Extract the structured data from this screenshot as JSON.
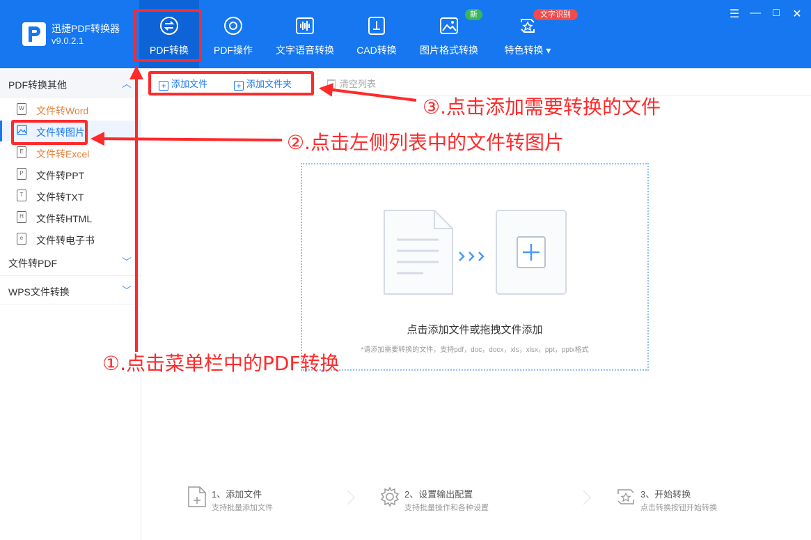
{
  "app": {
    "name": "迅捷PDF转换器",
    "version": "v9.0.2.1"
  },
  "nav": [
    {
      "label": "PDF转换",
      "icon": "convert-icon",
      "active": true
    },
    {
      "label": "PDF操作",
      "icon": "gear-circle-icon"
    },
    {
      "label": "文字语音转换",
      "icon": "waveform-icon"
    },
    {
      "label": "CAD转换",
      "icon": "cad-icon"
    },
    {
      "label": "图片格式转换",
      "icon": "image-icon"
    },
    {
      "label": "特色转换",
      "icon": "special-icon",
      "dropdown": true
    }
  ],
  "badges": {
    "new": "新",
    "ocr": "文字识别"
  },
  "window_controls": {
    "menu": "☰",
    "minimize": "—",
    "maximize": "□",
    "close": "✕"
  },
  "sidebar": {
    "groups": [
      {
        "label": "PDF转换其他",
        "expanded": true,
        "items": [
          {
            "label": "文件转Word",
            "icon_text": "W"
          },
          {
            "label": "文件转图片",
            "icon_text": "img",
            "active": true
          },
          {
            "label": "文件转Excel",
            "icon_text": "E"
          },
          {
            "label": "文件转PPT",
            "icon_text": "P"
          },
          {
            "label": "文件转TXT",
            "icon_text": "T"
          },
          {
            "label": "文件转HTML",
            "icon_text": "H"
          },
          {
            "label": "文件转电子书",
            "icon_text": "e"
          }
        ]
      },
      {
        "label": "文件转PDF",
        "expanded": false
      },
      {
        "label": "WPS文件转换",
        "expanded": false
      }
    ]
  },
  "toolbar": {
    "add_file": "添加文件",
    "add_folder": "添加文件夹",
    "clear_list": "清空列表"
  },
  "dropzone": {
    "title": "点击添加文件或拖拽文件添加",
    "hint": "*请添加需要转换的文件，支持pdf，doc，docx，xls，xlsx，ppt，pptx格式"
  },
  "steps": [
    {
      "title": "1、添加文件",
      "desc": "支持批量添加文件"
    },
    {
      "title": "2、设置输出配置",
      "desc": "支持批量操作和各种设置"
    },
    {
      "title": "3、开始转换",
      "desc": "点击转换按钮开始转换"
    }
  ],
  "annotations": {
    "step1": "①.点击菜单栏中的PDF转换",
    "step2": "②.点击左侧列表中的文件转图片",
    "step3": "③.点击添加需要转换的文件"
  },
  "colors": {
    "header": "#1677f0",
    "accent": "#1677f0",
    "orange": "#e8803a",
    "annotation": "#ff2a2a"
  }
}
